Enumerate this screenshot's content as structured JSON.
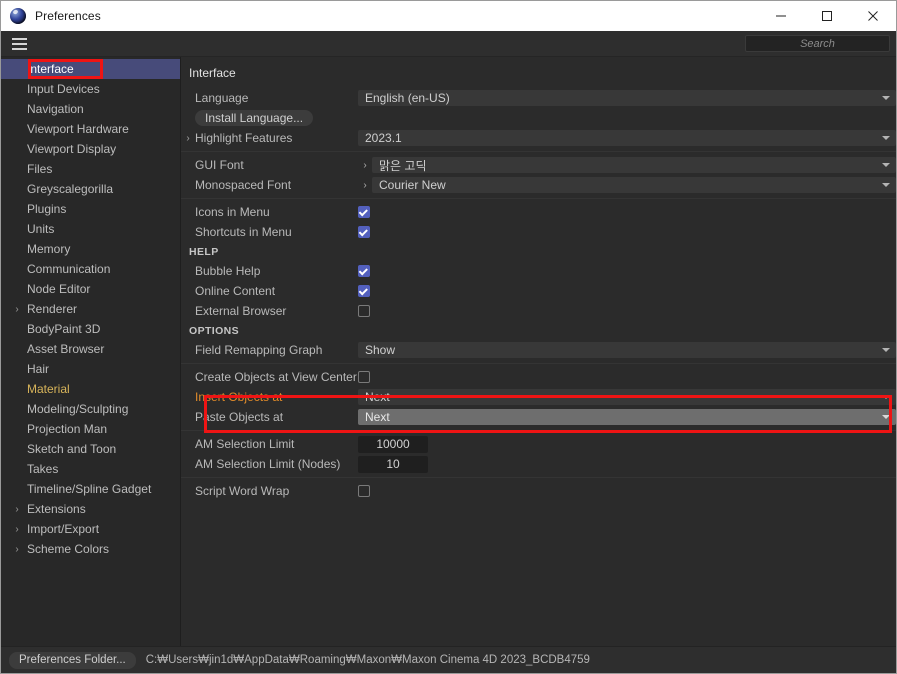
{
  "window": {
    "title": "Preferences",
    "app_icon": "cinema4d-icon",
    "minimize_label": "Minimize",
    "maximize_label": "Maximize",
    "close_label": "Close"
  },
  "menubar": {
    "hamburger_label": "Menu",
    "search": {
      "value": "",
      "placeholder": "Search"
    }
  },
  "sidebar": {
    "items": [
      {
        "label": "Interface",
        "selected": true,
        "expandable": false,
        "accent": false
      },
      {
        "label": "Input Devices",
        "selected": false,
        "expandable": false,
        "accent": false
      },
      {
        "label": "Navigation",
        "selected": false,
        "expandable": false,
        "accent": false
      },
      {
        "label": "Viewport Hardware",
        "selected": false,
        "expandable": false,
        "accent": false
      },
      {
        "label": "Viewport Display",
        "selected": false,
        "expandable": false,
        "accent": false
      },
      {
        "label": "Files",
        "selected": false,
        "expandable": false,
        "accent": false
      },
      {
        "label": "Greyscalegorilla",
        "selected": false,
        "expandable": false,
        "accent": false
      },
      {
        "label": "Plugins",
        "selected": false,
        "expandable": false,
        "accent": false
      },
      {
        "label": "Units",
        "selected": false,
        "expandable": false,
        "accent": false
      },
      {
        "label": "Memory",
        "selected": false,
        "expandable": false,
        "accent": false
      },
      {
        "label": "Communication",
        "selected": false,
        "expandable": false,
        "accent": false
      },
      {
        "label": "Node Editor",
        "selected": false,
        "expandable": false,
        "accent": false
      },
      {
        "label": "Renderer",
        "selected": false,
        "expandable": true,
        "accent": false
      },
      {
        "label": "BodyPaint 3D",
        "selected": false,
        "expandable": false,
        "accent": false
      },
      {
        "label": "Asset Browser",
        "selected": false,
        "expandable": false,
        "accent": false
      },
      {
        "label": "Hair",
        "selected": false,
        "expandable": false,
        "accent": false
      },
      {
        "label": "Material",
        "selected": false,
        "expandable": false,
        "accent": true
      },
      {
        "label": "Modeling/Sculpting",
        "selected": false,
        "expandable": false,
        "accent": false
      },
      {
        "label": "Projection Man",
        "selected": false,
        "expandable": false,
        "accent": false
      },
      {
        "label": "Sketch and Toon",
        "selected": false,
        "expandable": false,
        "accent": false
      },
      {
        "label": "Takes",
        "selected": false,
        "expandable": false,
        "accent": false
      },
      {
        "label": "Timeline/Spline Gadget",
        "selected": false,
        "expandable": false,
        "accent": false
      },
      {
        "label": "Extensions",
        "selected": false,
        "expandable": true,
        "accent": false
      },
      {
        "label": "Import/Export",
        "selected": false,
        "expandable": true,
        "accent": false
      },
      {
        "label": "Scheme Colors",
        "selected": false,
        "expandable": true,
        "accent": false
      }
    ]
  },
  "main": {
    "title": "Interface",
    "language": {
      "label": "Language",
      "value": "English (en-US)"
    },
    "install_language": {
      "label": "Install Language..."
    },
    "highlight_features": {
      "label": "Highlight Features",
      "value": "2023.1",
      "twisty": "›"
    },
    "gui_font": {
      "label": "GUI Font",
      "value": "맑은 고딕",
      "subarrow": "›"
    },
    "monospaced_font": {
      "label": "Monospaced Font",
      "value": "Courier New",
      "subarrow": "›"
    },
    "icons_in_menu": {
      "label": "Icons in Menu",
      "checked": true
    },
    "shortcuts_in_menu": {
      "label": "Shortcuts in Menu",
      "checked": true
    },
    "help_heading": "HELP",
    "bubble_help": {
      "label": "Bubble Help",
      "checked": true
    },
    "online_content": {
      "label": "Online Content",
      "checked": true
    },
    "external_browser": {
      "label": "External Browser",
      "checked": false
    },
    "options_heading": "OPTIONS",
    "field_remapping_graph": {
      "label": "Field Remapping Graph",
      "value": "Show"
    },
    "create_objects_at_view_center": {
      "label": "Create Objects at View Center",
      "checked": false
    },
    "insert_objects_at": {
      "label": "Insert Objects at",
      "value": "Next",
      "modified": true
    },
    "paste_objects_at": {
      "label": "Paste Objects at",
      "value": "Next",
      "hovered": true
    },
    "am_selection_limit": {
      "label": "AM Selection Limit",
      "value": "10000"
    },
    "am_selection_limit_nodes": {
      "label": "AM Selection Limit (Nodes)",
      "value": "10"
    },
    "script_word_wrap": {
      "label": "Script Word Wrap",
      "checked": false
    }
  },
  "footer": {
    "preferences_folder_button": "Preferences Folder...",
    "path": "C:₩Users₩jin1d₩AppData₩Roaming₩Maxon₩Maxon Cinema 4D 2023_BCDB4759"
  },
  "annotations": {
    "interface_box": "highlight-interface",
    "objects_box": "highlight-insert-paste-objects"
  },
  "colors": {
    "accent_selection": "#474b7a",
    "accent_material": "#d7b45a",
    "accent_modified": "#e08b2a",
    "checkbox_checked": "#5360bd",
    "annotation": "#ef1414"
  }
}
